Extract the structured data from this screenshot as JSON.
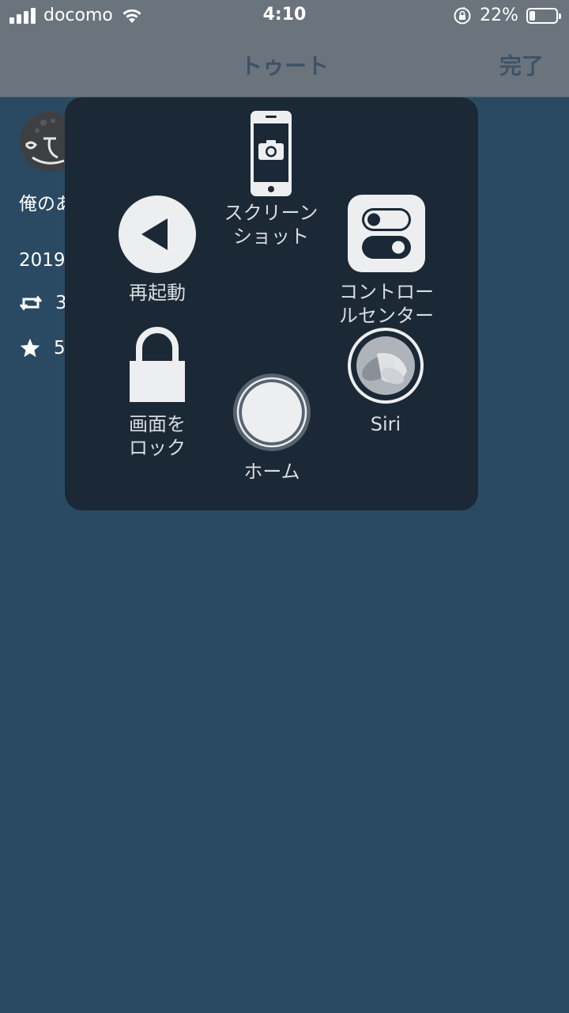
{
  "status_bar": {
    "carrier": "docomo",
    "time": "4:10",
    "battery_percent": "22%",
    "battery_level": 0.22
  },
  "nav": {
    "title": "トゥート",
    "done_label": "完了"
  },
  "tweet": {
    "text": "俺のあ",
    "date": "2019",
    "retweets": "3",
    "favorites": "5"
  },
  "assistive_touch": {
    "screenshot_line1": "スクリーン",
    "screenshot_line2": "ショット",
    "restart_label": "再起動",
    "control_center_line1": "コントロー",
    "control_center_line2": "ルセンター",
    "lock_line1": "画面を",
    "lock_line2": "ロック",
    "siri_label": "Siri",
    "home_label": "ホーム"
  },
  "colors": {
    "status_bar_bg": "#6b747d",
    "page_bg": "#2a4a63",
    "menu_bg": "#1b2835",
    "menu_text": "#d8dde2"
  }
}
